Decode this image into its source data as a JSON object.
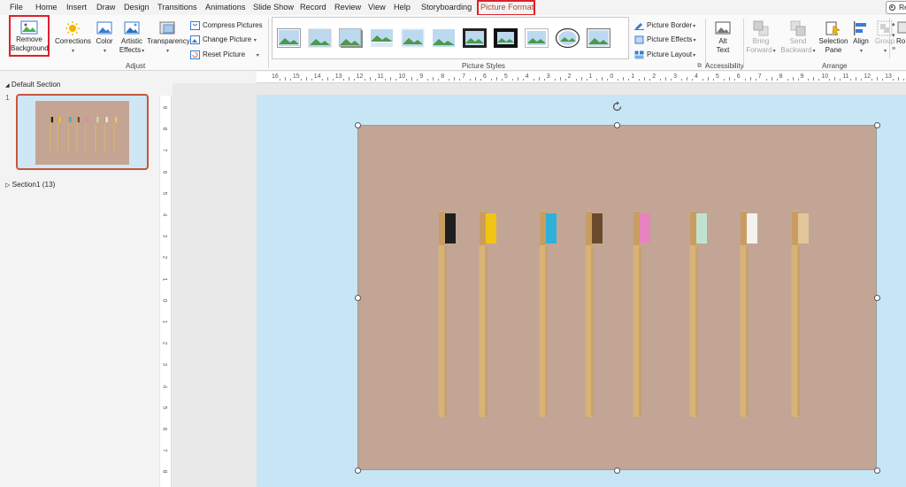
{
  "tabs": [
    {
      "label": "File",
      "id": "file"
    },
    {
      "label": "Home",
      "id": "home"
    },
    {
      "label": "Insert",
      "id": "insert"
    },
    {
      "label": "Draw",
      "id": "draw"
    },
    {
      "label": "Design",
      "id": "design"
    },
    {
      "label": "Transitions",
      "id": "transitions"
    },
    {
      "label": "Animations",
      "id": "animations"
    },
    {
      "label": "Slide Show",
      "id": "slide-show"
    },
    {
      "label": "Record",
      "id": "record"
    },
    {
      "label": "Review",
      "id": "review"
    },
    {
      "label": "View",
      "id": "view"
    },
    {
      "label": "Help",
      "id": "help"
    },
    {
      "label": "Storyboarding",
      "id": "storyboarding"
    },
    {
      "label": "Picture Format",
      "id": "picture-format",
      "active": true
    }
  ],
  "record_button": {
    "label": "Re"
  },
  "adjust": {
    "remove_bg_line1": "Remove",
    "remove_bg_line2": "Background",
    "corrections": "Corrections",
    "color": "Color",
    "artistic_line1": "Artistic",
    "artistic_line2": "Effects",
    "transparency": "Transparency",
    "compress": "Compress Pictures",
    "change": "Change Picture",
    "reset": "Reset Picture",
    "group_label": "Adjust"
  },
  "picture_styles": {
    "group_label": "Picture Styles",
    "border": "Picture Border",
    "effects": "Picture Effects",
    "layout": "Picture Layout"
  },
  "accessibility": {
    "alt_line1": "Alt",
    "alt_line2": "Text",
    "group_label": "Accessibility"
  },
  "arrange": {
    "bring_line1": "Bring",
    "bring_line2": "Forward",
    "send_line1": "Send",
    "send_line2": "Backward",
    "selection_line1": "Selection",
    "selection_line2": "Pane",
    "align": "Align",
    "group": "Group",
    "rotate": "Ro",
    "group_label": "Arrange"
  },
  "slides_pane": {
    "section1": "Default Section",
    "slide_number": "1",
    "section2": "Section1 (13)"
  },
  "hruler_labels": [
    "16",
    "15",
    "14",
    "13",
    "12",
    "11",
    "10",
    "9",
    "8",
    "7",
    "6",
    "5",
    "4",
    "3",
    "2",
    "1",
    "0",
    "1",
    "2",
    "3",
    "4",
    "5",
    "6",
    "7",
    "8",
    "9",
    "10",
    "11",
    "12",
    "13"
  ],
  "vruler_labels": [
    "9",
    "8",
    "7",
    "6",
    "5",
    "4",
    "3",
    "2",
    "1",
    "0",
    "1",
    "2",
    "3",
    "4",
    "5",
    "6",
    "7",
    "8"
  ],
  "toothbrushes": [
    {
      "bristle": "#1f1f1f"
    },
    {
      "bristle": "#f2c414"
    },
    {
      "bristle": "#2fb0d8"
    },
    {
      "bristle": "#6b4a2c"
    },
    {
      "bristle": "#e784c0"
    },
    {
      "bristle": "#bfe3cf"
    },
    {
      "bristle": "#f4f2ee"
    },
    {
      "bristle": "#e3c69a"
    }
  ],
  "colors": {
    "accent": "#b7472a",
    "highlight": "#e0202a",
    "slide_bg": "#c6e6f6",
    "picture_bg": "#c3a595",
    "handle_wood": "#d9b277"
  }
}
